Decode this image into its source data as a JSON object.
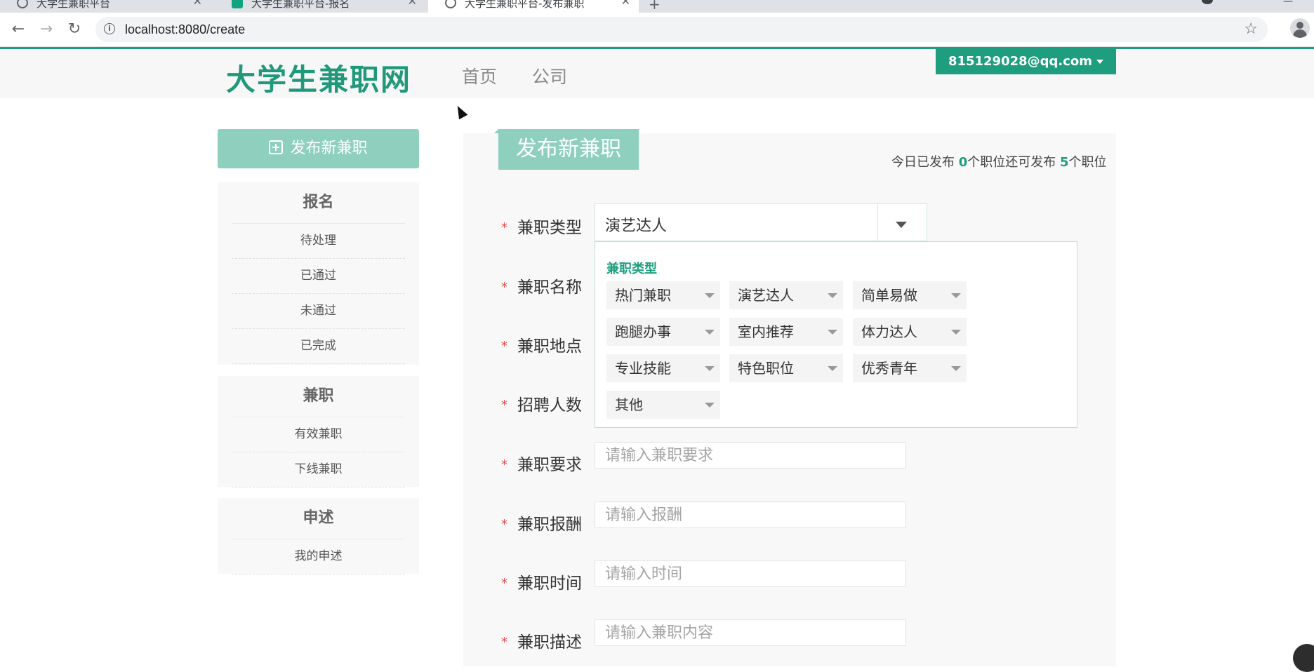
{
  "browser": {
    "tabs": [
      {
        "title": "大学生兼职平台",
        "active": false
      },
      {
        "title": "大学生兼职平台-报名",
        "active": false
      },
      {
        "title": "大学生兼职平台-发布兼职",
        "active": true
      }
    ],
    "url": "localhost:8080/create",
    "accent_color": "#1e9e7e"
  },
  "header": {
    "logo": "大学生兼职网",
    "nav": [
      "首页",
      "公司"
    ],
    "user": "815129028@qq.com"
  },
  "sidebar": {
    "publish_button": "发布新兼职",
    "groups": [
      {
        "title": "报名",
        "items": [
          "待处理",
          "已通过",
          "未通过",
          "已完成"
        ]
      },
      {
        "title": "兼职",
        "items": [
          "有效兼职",
          "下线兼职"
        ]
      },
      {
        "title": "申述",
        "items": [
          "我的申述"
        ]
      }
    ]
  },
  "main": {
    "title": "发布新兼职",
    "quota": {
      "prefix": "今日已发布 ",
      "published": "0",
      "middle": "个职位还可发布 ",
      "remaining": "5",
      "suffix": "个职位"
    },
    "fields": [
      {
        "label": "兼职类型"
      },
      {
        "label": "兼职名称"
      },
      {
        "label": "兼职地点"
      },
      {
        "label": "招聘人数"
      },
      {
        "label": "兼职要求",
        "placeholder": "请输入兼职要求"
      },
      {
        "label": "兼职报酬",
        "placeholder": "请输入报酬"
      },
      {
        "label": "兼职时间",
        "placeholder": "请输入时间"
      },
      {
        "label": "兼职描述",
        "placeholder": "请输入兼职内容"
      }
    ],
    "type_select": {
      "value": "演艺达人",
      "dropdown_title": "兼职类型",
      "options": [
        "热门兼职",
        "演艺达人",
        "简单易做",
        "跑腿办事",
        "室内推荐",
        "体力达人",
        "专业技能",
        "特色职位",
        "优秀青年",
        "其他"
      ]
    }
  }
}
